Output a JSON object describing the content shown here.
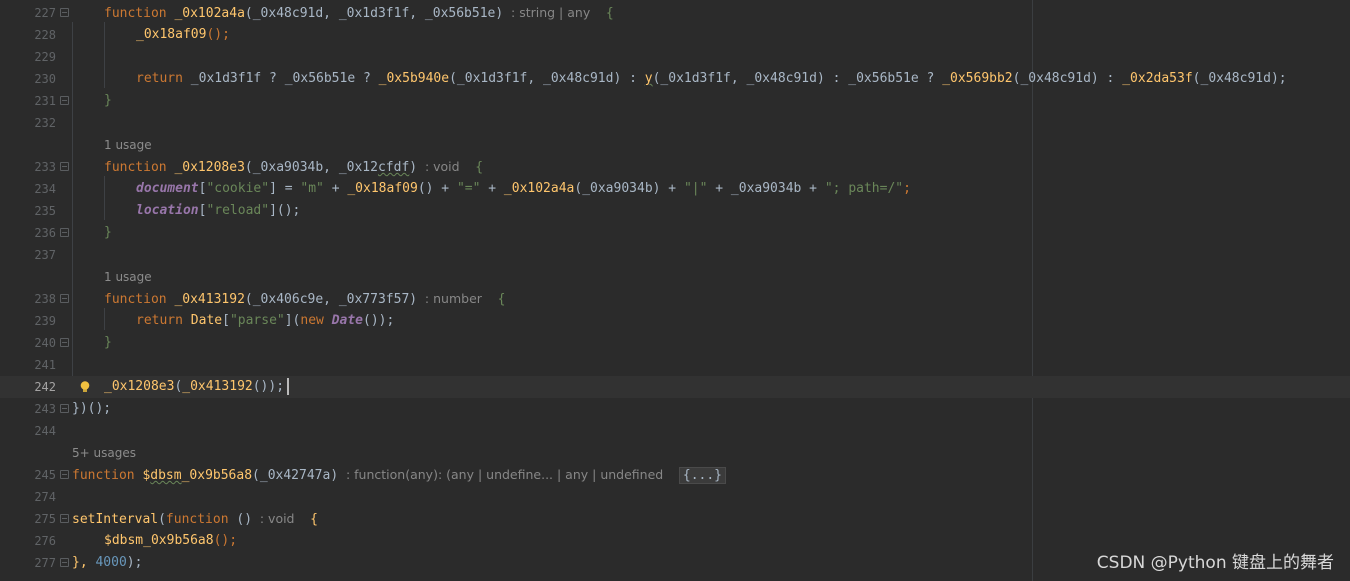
{
  "colors": {
    "background": "#2b2b2b",
    "keyword": "#cc7832",
    "function": "#ffc66d",
    "string": "#6a8759",
    "number": "#6897bb",
    "global": "#9876aa",
    "text": "#a9b7c6",
    "hint": "#878787"
  },
  "lines": {
    "l227": "227",
    "l228": "228",
    "l229": "229",
    "l230": "230",
    "l231": "231",
    "l232": "232",
    "l233": "233",
    "l234": "234",
    "l235": "235",
    "l236": "236",
    "l237": "237",
    "l238": "238",
    "l239": "239",
    "l240": "240",
    "l241": "241",
    "l242": "242",
    "l243": "243",
    "l244": "244",
    "l245": "245",
    "l274": "274",
    "l275": "275",
    "l276": "276",
    "l277": "277"
  },
  "code": {
    "kw_function": "function",
    "kw_return": "return",
    "kw_new": "new",
    "f227_name": "_0x102a4a",
    "f227_params": "(_0x48c91d, _0x1d3f1f, _0x56b51e)",
    "f227_type": ": string | any",
    "open_brace": "{",
    "close_brace": "}",
    "l228_call": "_0x18af09",
    "parens_semi": "();",
    "l230_a": " _0x1d3f1f ? _0x56b51e ? ",
    "l230_fn1": "_0x5b940e",
    "l230_b": "(_0x1d3f1f, _0x48c91d) : ",
    "l230_fn2": "y",
    "l230_c": "(_0x1d3f1f, _0x48c91d) : _0x56b51e ? ",
    "l230_fn3": "_0x569bb2",
    "l230_d": "(_0x48c91d) : ",
    "l230_fn4": "_0x2da53f",
    "l230_e": "(_0x48c91d);",
    "usage_1": "1 usage",
    "usage_5": "5+ usages",
    "f233_name": "_0x1208e3",
    "f233_params_a": "(_0xa9034b, _0x12",
    "f233_params_sq": "cfdf",
    "f233_params_b": ")",
    "f233_type": ": void",
    "l234_doc": "document",
    "l234_a": "[",
    "l234_cookie": "\"cookie\"",
    "l234_b": "] = ",
    "l234_m": "\"m\"",
    "l234_c": " + ",
    "l234_fn1": "_0x18af09",
    "l234_d": "() + ",
    "l234_eq": "\"=\"",
    "l234_e": " + ",
    "l234_fn2": "_0x102a4a",
    "l234_f": "(_0xa9034b) + ",
    "l234_pipe": "\"|\"",
    "l234_g": " + _0xa9034b + ",
    "l234_path": "\"; path=/\"",
    "l234_h": ";",
    "l235_loc": "location",
    "l235_a": "[",
    "l235_reload": "\"reload\"",
    "l235_b": "]();",
    "f238_name": "_0x413192",
    "f238_params": "(_0x406c9e, _0x773f57)",
    "f238_type": ": number",
    "l239_date": "Date",
    "l239_a": "[",
    "l239_parse": "\"parse\"",
    "l239_b": "](",
    "l239_date2": "Date",
    "l239_c": "());",
    "l242_fn1": "_0x1208e3",
    "l242_a": "(",
    "l242_fn2": "_0x413192",
    "l242_b": "());",
    "l243": "})();",
    "f245_name_a": "$",
    "f245_name_sq": "dbsm",
    "f245_name_b": "_0x9b56a8",
    "f245_params": "(_0x42747a)",
    "f245_type": ": function(any): (any | undefine... | any | undefined",
    "f245_collapsed": "{...}",
    "l275_fn": "setInterval",
    "l275_a": "(",
    "l275_b": " () ",
    "l275_type": ": void",
    "l276_fn": "$dbsm_0x9b56a8",
    "l277_a": "}, ",
    "l277_num": "4000",
    "l277_b": ");"
  },
  "watermark": "CSDN @Python  键盘上的舞者"
}
